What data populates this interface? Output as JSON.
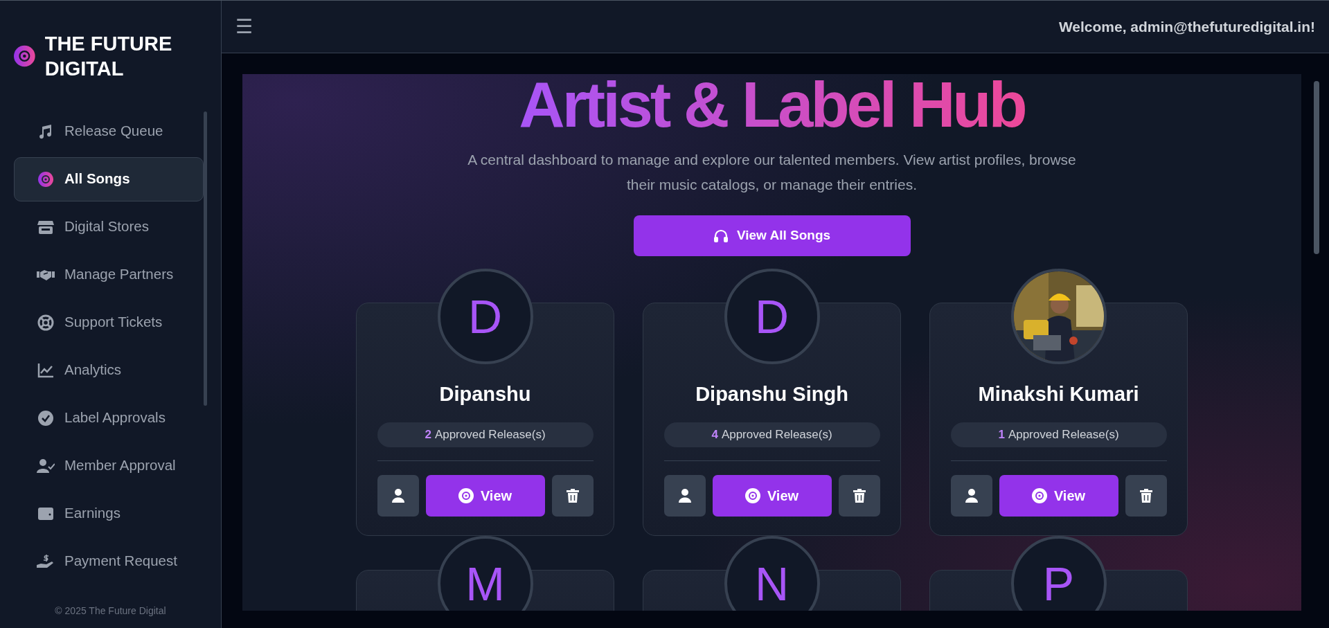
{
  "brand": {
    "name": "THE FUTURE DIGITAL"
  },
  "sidebar": {
    "items": [
      {
        "label": "Release Queue",
        "selected": false
      },
      {
        "label": "All Songs",
        "selected": true
      },
      {
        "label": "Digital Stores",
        "selected": false
      },
      {
        "label": "Manage Partners",
        "selected": false
      },
      {
        "label": "Support Tickets",
        "selected": false
      },
      {
        "label": "Analytics",
        "selected": false
      },
      {
        "label": "Label Approvals",
        "selected": false
      },
      {
        "label": "Member Approval",
        "selected": false
      },
      {
        "label": "Earnings",
        "selected": false
      },
      {
        "label": "Payment Request",
        "selected": false
      }
    ],
    "footer": "© 2025 The Future Digital"
  },
  "topbar": {
    "menu": "☰",
    "welcome": "Welcome, admin@thefuturedigital.in!"
  },
  "hero": {
    "title": "Artist & Label Hub",
    "subtitle": "A central dashboard to manage and explore our talented members. View artist profiles, browse their music catalogs, or manage their entries.",
    "button": "View All Songs"
  },
  "members": [
    {
      "kind": "initial",
      "initial": "D",
      "name": "Dipanshu",
      "count": "2",
      "count_label": "Approved Release(s)",
      "view": "View"
    },
    {
      "kind": "initial",
      "initial": "D",
      "name": "Dipanshu Singh",
      "count": "4",
      "count_label": "Approved Release(s)",
      "view": "View"
    },
    {
      "kind": "picture",
      "name": "Minakshi Kumari",
      "count": "1",
      "count_label": "Approved Release(s)",
      "view": "View"
    },
    {
      "kind": "initial",
      "initial": "M"
    },
    {
      "kind": "initial",
      "initial": "N"
    },
    {
      "kind": "initial",
      "initial": "P"
    }
  ]
}
